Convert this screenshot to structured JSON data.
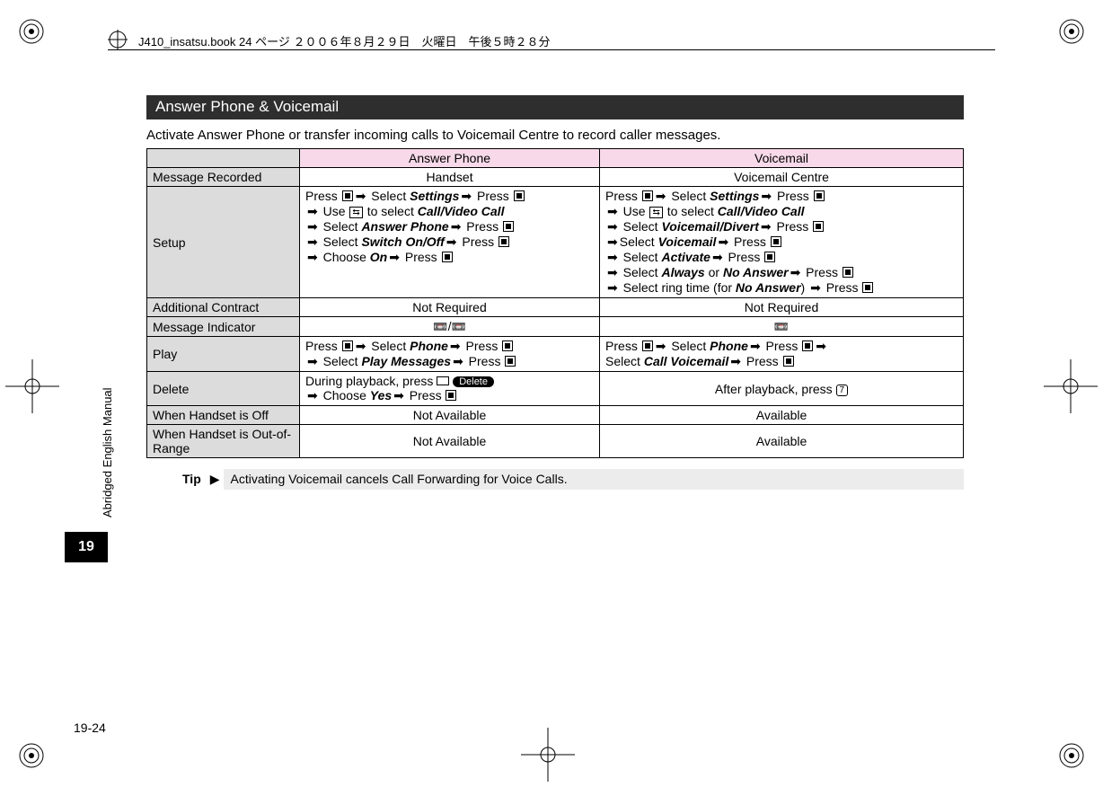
{
  "print_header": "J410_insatsu.book  24 ページ  ２００６年８月２９日　火曜日　午後５時２８分",
  "sidebar": {
    "label": "Abridged English Manual",
    "chapter": "19"
  },
  "page_number": "19-24",
  "section_title": "Answer Phone & Voicemail",
  "intro": "Activate Answer Phone or transfer incoming calls to Voicemail Centre to record caller messages.",
  "table": {
    "col_ap": "Answer Phone",
    "col_vm": "Voicemail",
    "rows": {
      "message_recorded": {
        "label": "Message Recorded",
        "ap": "Handset",
        "vm": "Voicemail Centre"
      },
      "setup": {
        "label": "Setup",
        "ap": {
          "l1a": "Press ",
          "l1b": " Select ",
          "l1c": "Settings",
          "l1d": " Press ",
          "l2a": " Use ",
          "l2b": " to select  ",
          "l2c": "Call/Video Call",
          "l3a": " Select ",
          "l3b": "Answer Phone",
          "l3c": " Press ",
          "l4a": " Select ",
          "l4b": "Switch On/Off",
          "l4c": " Press ",
          "l5a": " Choose ",
          "l5b": "On",
          "l5c": " Press "
        },
        "vm": {
          "l1a": "Press ",
          "l1b": " Select ",
          "l1c": "Settings",
          "l1d": " Press ",
          "l2a": " Use ",
          "l2b": " to select ",
          "l2c": "Call/Video Call",
          "l3a": " Select ",
          "l3b": "Voicemail/Divert",
          "l3c": " Press ",
          "l4a": "Select ",
          "l4b": "Voicemail",
          "l4c": " Press ",
          "l5a": " Select ",
          "l5b": "Activate",
          "l5c": " Press ",
          "l6a": " Select ",
          "l6b": "Always",
          "l6c": " or ",
          "l6d": "No Answer",
          "l6e": " Press ",
          "l7a": " Select ring time (for ",
          "l7b": "No Answer",
          "l7c": ") ",
          "l7d": " Press "
        }
      },
      "contract": {
        "label": "Additional Contract",
        "ap": "Not Required",
        "vm": "Not Required"
      },
      "indicator": {
        "label": "Message Indicator",
        "ap_sep": "/",
        "vm": " "
      },
      "play": {
        "label": "Play",
        "ap": {
          "l1a": "Press ",
          "l1b": " Select ",
          "l1c": "Phone",
          "l1d": " Press ",
          "l2a": " Select ",
          "l2b": "Play Messages",
          "l2c": " Press "
        },
        "vm": {
          "l1a": "Press ",
          "l1b": " Select ",
          "l1c": "Phone",
          "l1d": " Press ",
          "l2a": "Select ",
          "l2b": "Call Voicemail",
          "l2c": " Press "
        }
      },
      "delete": {
        "label": "Delete",
        "ap": {
          "l1": "During playback, press ",
          "badge": "Delete",
          "l2a": " Choose ",
          "l2b": "Yes",
          "l2c": " Press "
        },
        "vm": {
          "l1": "After playback, press ",
          "key": "7"
        }
      },
      "off": {
        "label": "When Handset is Off",
        "ap": "Not Available",
        "vm": "Available"
      },
      "oor": {
        "label": "When Handset is Out-of-Range",
        "ap": "Not Available",
        "vm": "Available"
      }
    }
  },
  "tip": {
    "label": "Tip",
    "body": "Activating Voicemail cancels Call Forwarding for Voice Calls."
  }
}
